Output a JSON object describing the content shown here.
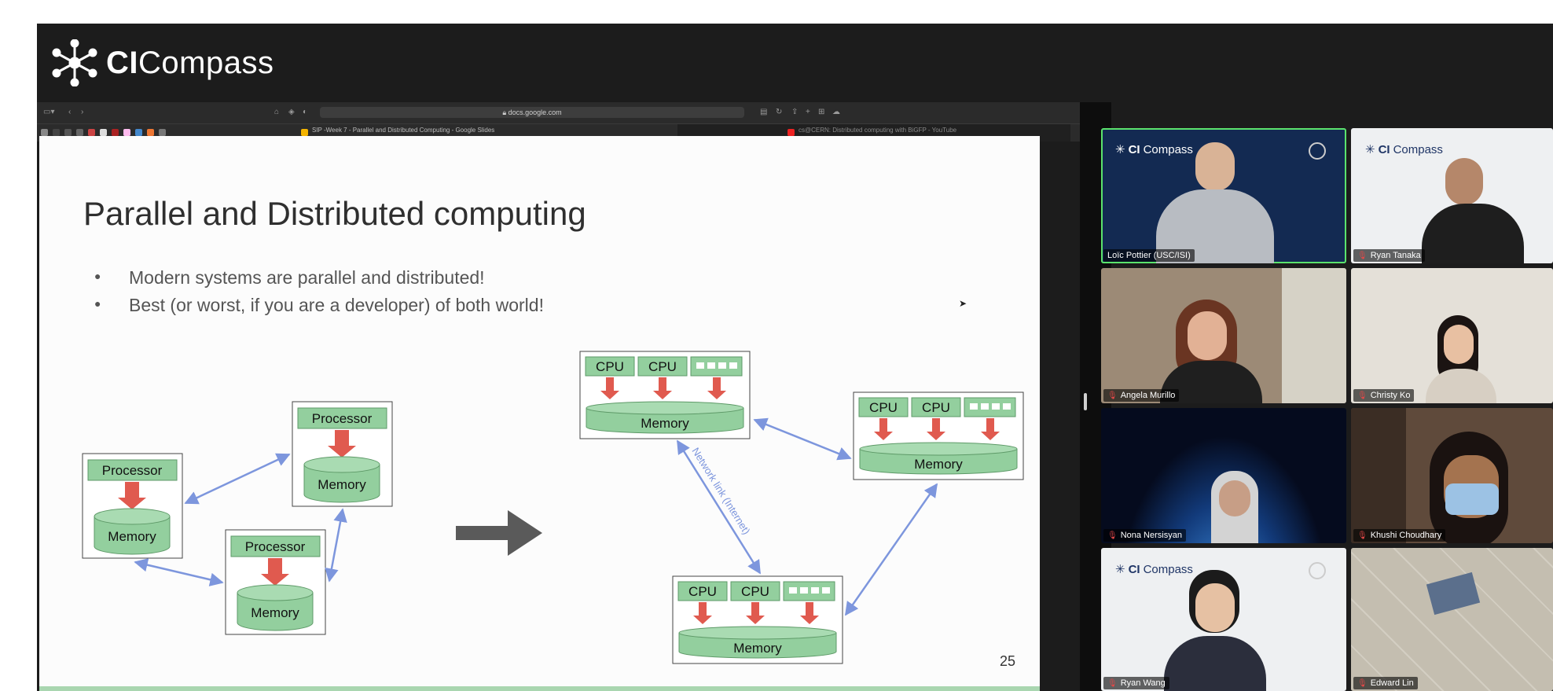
{
  "header": {
    "logo_text_bold": "CI",
    "logo_text_regular": "Compass"
  },
  "browser": {
    "url": "docs.google.com",
    "tabs": [
      {
        "label": "SIP -Week 7 - Parallel and Distributed Computing - Google Slides"
      },
      {
        "label": "cs@CERN: Distributed computing with BiGFP - YouTube"
      }
    ]
  },
  "slide": {
    "title": "Parallel and Distributed computing",
    "bullets": [
      "Modern systems are parallel and distributed!",
      "Best (or worst, if you are a developer) of both world!"
    ],
    "page_number": "25",
    "left_diagram": {
      "processor_label": "Processor",
      "memory_label": "Memory"
    },
    "right_diagram": {
      "cpu_label": "CPU",
      "memory_label": "Memory",
      "network_label": "Network link (Internet)"
    },
    "colors": {
      "box_green": "#93cf9e",
      "arrow_red": "#e05a4f",
      "link_blue": "#7d96dd",
      "big_arrow": "#5a5a5a"
    }
  },
  "participants": [
    {
      "name": "Loïc Pottier (USC/ISI)",
      "active": true,
      "muted": false,
      "background": "cicompass-dark"
    },
    {
      "name": "Ryan Tanaka",
      "muted": true,
      "background": "cicompass-light"
    },
    {
      "name": "Angela Murillo",
      "muted": true,
      "background": "room"
    },
    {
      "name": "Christy Ko",
      "muted": true,
      "background": "wall"
    },
    {
      "name": "Nona Nersisyan",
      "muted": true,
      "background": "earth"
    },
    {
      "name": "Khushi Choudhary",
      "muted": true,
      "background": "building"
    },
    {
      "name": "Ryan Wang",
      "muted": true,
      "background": "cicompass-light"
    },
    {
      "name": "Edward Lin",
      "muted": true,
      "background": "ceiling"
    }
  ],
  "tile_logo": {
    "bold": "CI",
    "regular": "Compass"
  }
}
